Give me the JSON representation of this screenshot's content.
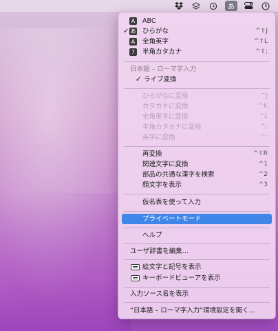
{
  "colors": {
    "highlight": "#3f86e8",
    "menu_bg": "#f0d4f0"
  },
  "menubar": {
    "icons": [
      "dropbox-icon",
      "layers-icon",
      "clock-history-icon",
      "input-method-icon",
      "control-center-icon",
      "clock-icon"
    ],
    "input_method_glyph": "あ"
  },
  "menu": {
    "abc": "ABC",
    "hiragana": "ひらがな",
    "hiragana_sc": "^⇧J",
    "zenkaku_eiji": "全角英字",
    "zenkaku_eiji_sc": "^⇧L",
    "hankaku_katakana": "半角カタカナ",
    "hankaku_katakana_sc": "^⇧;",
    "section_header": "日本語 – ローマ字入力",
    "live_conversion": "ライブ変換",
    "to_hiragana": "ひらがなに変換",
    "to_hiragana_sc": "^J",
    "to_katakana": "カタカナに変換",
    "to_katakana_sc": "^K",
    "to_zenkaku_eiji": "全角英字に変換",
    "to_zenkaku_eiji_sc": "^L",
    "to_hankaku_katakana": "半角カタカナに変換",
    "to_hankaku_katakana_sc": "^;",
    "to_eiji": "英字に変換",
    "to_eiji_sc": "^:",
    "reconvert": "再変換",
    "reconvert_sc": "^⇧R",
    "related_chars": "関連文字に変換",
    "related_chars_sc": "^1",
    "search_kanji": "部品の共通な漢字を検索",
    "search_kanji_sc": "^2",
    "emoticon": "顔文字を表示",
    "emoticon_sc": "^3",
    "kana_table": "仮名表を使って入力",
    "private_mode": "プライベートモード",
    "help": "ヘルプ",
    "edit_dictionary": "ユーザ辞書を編集...",
    "emoji_symbols": "絵文字と記号を表示",
    "keyboard_viewer": "キーボードビューアを表示",
    "show_source_name": "入力ソース名を表示",
    "open_prefs": "“日本語 – ローマ字入力”環境設定を開く..."
  }
}
